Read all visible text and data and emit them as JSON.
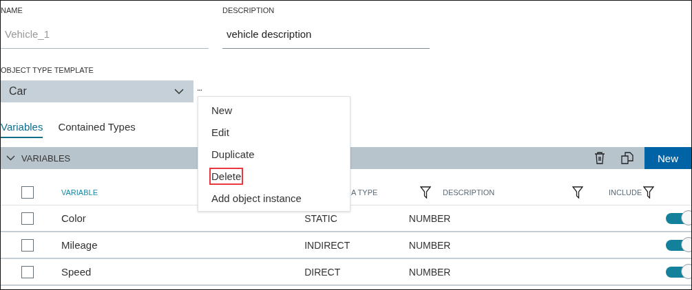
{
  "name_field": {
    "label": "NAME",
    "value": "Vehicle_1",
    "disabled": true
  },
  "description_field": {
    "label": "DESCRIPTION",
    "value": "vehicle description"
  },
  "template": {
    "label": "OBJECT TYPE TEMPLATE",
    "value": "Car",
    "more": "..."
  },
  "tabs": [
    {
      "label": "Variables",
      "selected": true
    },
    {
      "label": "Contained Types",
      "selected": false
    }
  ],
  "context_menu": [
    {
      "label": "New",
      "highlighted": false
    },
    {
      "label": "Edit",
      "highlighted": false
    },
    {
      "label": "Duplicate",
      "highlighted": false
    },
    {
      "label": "Delete",
      "highlighted": true
    },
    {
      "label": "Add object instance",
      "highlighted": false
    }
  ],
  "panel": {
    "title": "VARIABLES",
    "expanded": true,
    "new_button": "New"
  },
  "table": {
    "all_checked": false,
    "columns": [
      "VARIABLE",
      "A TYPE",
      "DESCRIPTION",
      "INCLUDE"
    ],
    "rows": [
      {
        "checked": false,
        "variable": "Color",
        "type": "STATIC",
        "data_type": "NUMBER",
        "description": "",
        "include": true
      },
      {
        "checked": false,
        "variable": "Mileage",
        "type": "INDIRECT",
        "data_type": "NUMBER",
        "description": "",
        "include": true
      },
      {
        "checked": false,
        "variable": "Speed",
        "type": "DIRECT",
        "data_type": "NUMBER",
        "description": "",
        "include": true
      }
    ]
  }
}
